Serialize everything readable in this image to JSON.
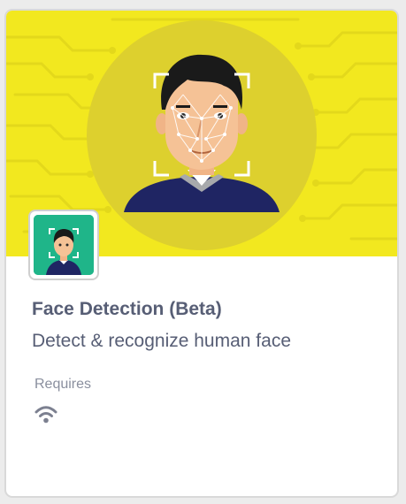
{
  "extension": {
    "title": "Face Detection (Beta)",
    "description": "Detect & recognize human face",
    "requires_label": "Requires",
    "requirements": [
      "wifi-icon"
    ]
  },
  "colors": {
    "banner_background": "#f2e81f",
    "banner_circle": "#ddd02e",
    "tile_background": "#1fb589",
    "text_primary": "#575e75",
    "text_secondary": "#8a8f9e"
  }
}
